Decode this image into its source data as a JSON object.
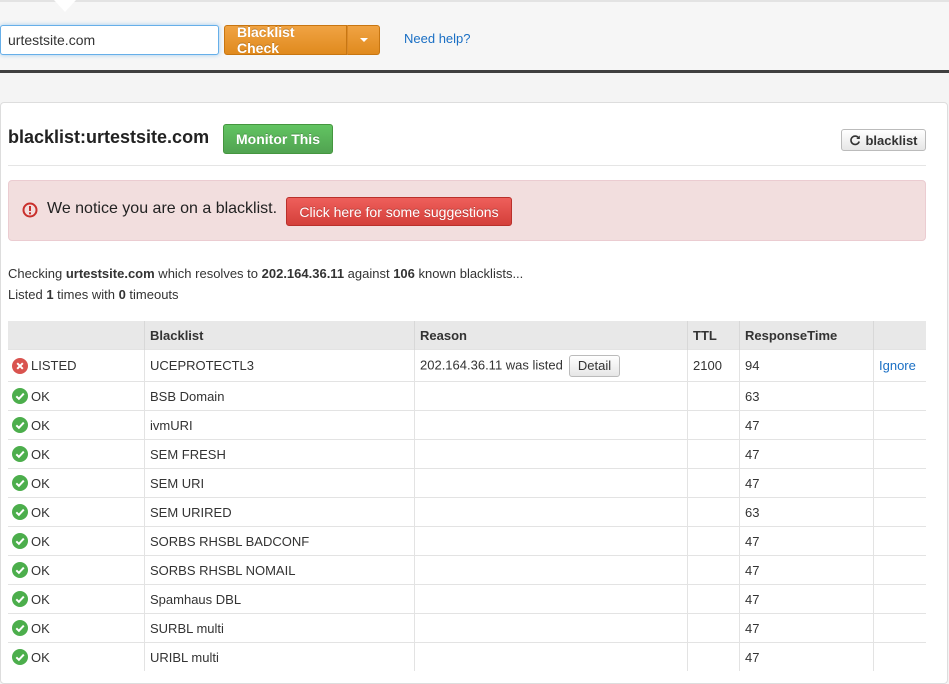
{
  "search": {
    "value": "urtestsite.com"
  },
  "toolbar": {
    "check_label": "Blacklist Check",
    "help_label": "Need help?"
  },
  "header": {
    "title": "blacklist:urtestsite.com",
    "monitor_label": "Monitor This",
    "refresh_label": "blacklist"
  },
  "alert": {
    "message": "We notice you are on a blacklist.",
    "button_label": "Click here for some suggestions"
  },
  "summary": {
    "p1": "Checking ",
    "domain": "urtestsite.com",
    "p2": " which resolves to ",
    "ip": "202.164.36.11",
    "p3": " against ",
    "count": "106",
    "p4": " known blacklists...",
    "p5": "Listed ",
    "listed": "1",
    "p6": " times with ",
    "timeouts": "0",
    "p7": " timeouts"
  },
  "table": {
    "headers": [
      "",
      "Blacklist",
      "Reason",
      "TTL",
      "ResponseTime",
      ""
    ],
    "rows": [
      {
        "status": "LISTED",
        "blacklist": "UCEPROTECTL3",
        "reason": "202.164.36.11 was listed",
        "detail": "Detail",
        "ttl": "2100",
        "response": "94",
        "action": "Ignore"
      },
      {
        "status": "OK",
        "blacklist": "BSB Domain",
        "reason": "",
        "ttl": "",
        "response": "63",
        "action": ""
      },
      {
        "status": "OK",
        "blacklist": "ivmURI",
        "reason": "",
        "ttl": "",
        "response": "47",
        "action": ""
      },
      {
        "status": "OK",
        "blacklist": "SEM FRESH",
        "reason": "",
        "ttl": "",
        "response": "47",
        "action": ""
      },
      {
        "status": "OK",
        "blacklist": "SEM URI",
        "reason": "",
        "ttl": "",
        "response": "47",
        "action": ""
      },
      {
        "status": "OK",
        "blacklist": "SEM URIRED",
        "reason": "",
        "ttl": "",
        "response": "63",
        "action": ""
      },
      {
        "status": "OK",
        "blacklist": "SORBS RHSBL BADCONF",
        "reason": "",
        "ttl": "",
        "response": "47",
        "action": ""
      },
      {
        "status": "OK",
        "blacklist": "SORBS RHSBL NOMAIL",
        "reason": "",
        "ttl": "",
        "response": "47",
        "action": ""
      },
      {
        "status": "OK",
        "blacklist": "Spamhaus DBL",
        "reason": "",
        "ttl": "",
        "response": "47",
        "action": ""
      },
      {
        "status": "OK",
        "blacklist": "SURBL multi",
        "reason": "",
        "ttl": "",
        "response": "47",
        "action": ""
      },
      {
        "status": "OK",
        "blacklist": "URIBL multi",
        "reason": "",
        "ttl": "",
        "response": "47",
        "action": ""
      }
    ]
  },
  "colors": {
    "ok": "#4cae4c",
    "listed": "#d9534f",
    "link": "#1a6fc4"
  }
}
